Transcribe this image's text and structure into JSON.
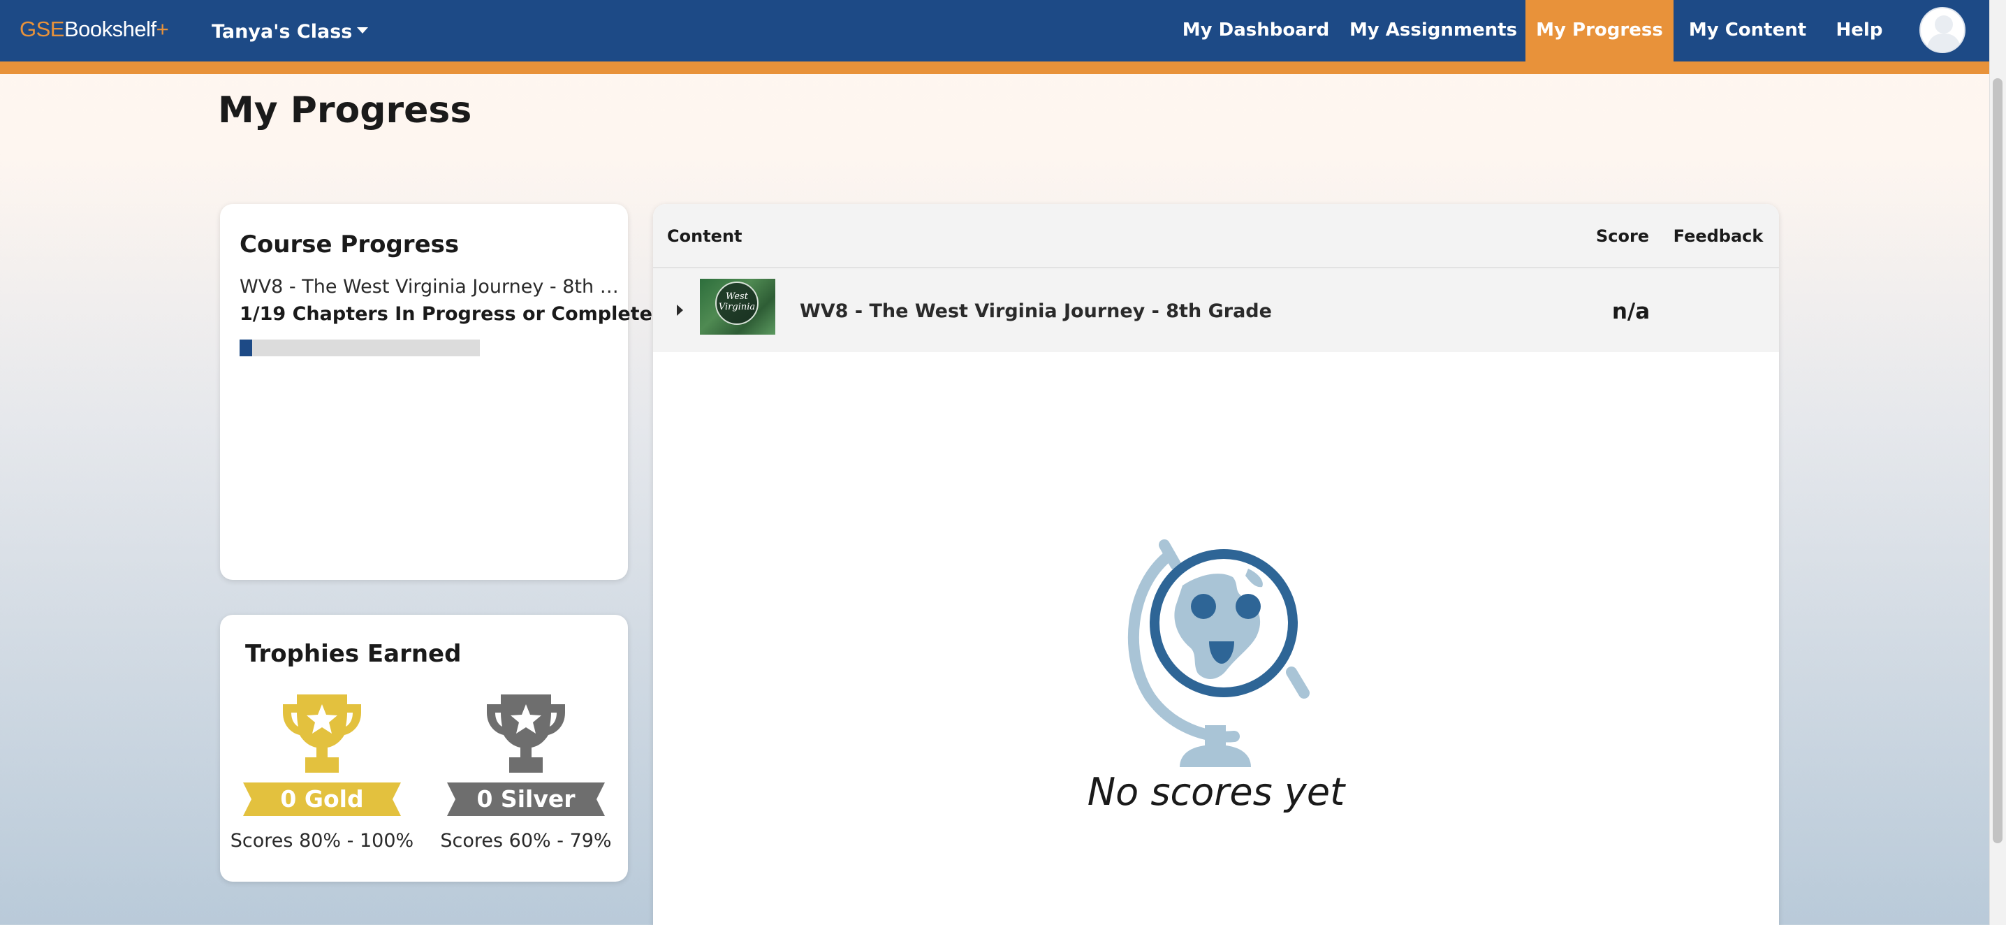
{
  "app": {
    "logo_gse": "GSE",
    "logo_bookshelf": "Bookshelf",
    "logo_plus": "+",
    "class_selector": "Tanya's Class"
  },
  "nav": {
    "items": [
      {
        "label": "My Dashboard",
        "active": false
      },
      {
        "label": "My Assignments",
        "active": false
      },
      {
        "label": "My Progress",
        "active": true
      },
      {
        "label": "My Content",
        "active": false
      },
      {
        "label": "Help",
        "active": false
      }
    ],
    "avatar_icon": "user-avatar-icon"
  },
  "page": {
    "title": "My Progress"
  },
  "course_progress": {
    "title": "Course Progress",
    "course_name": "WV8 - The West Virginia Journey - 8th Grade",
    "chapters_text": "1/19 Chapters In Progress or Complete",
    "chapters_done": 1,
    "chapters_total": 19
  },
  "trophies": {
    "title": "Trophies Earned",
    "gold": {
      "label": "0 Gold",
      "range": "Scores 80% - 100%",
      "icon": "gold-trophy-icon"
    },
    "silver": {
      "label": "0 Silver",
      "range": "Scores 60% - 79%",
      "icon": "silver-trophy-icon"
    }
  },
  "content_table": {
    "columns": {
      "content": "Content",
      "score": "Score",
      "feedback": "Feedback"
    },
    "rows": [
      {
        "thumbnail_text": "West Virginia",
        "title": "WV8 - The West Virginia Journey - 8th Grade",
        "score": "n/a",
        "feedback": ""
      }
    ],
    "empty_state": {
      "icon": "globe-icon",
      "text": "No scores yet"
    }
  },
  "colors": {
    "nav_background": "#1d4a86",
    "accent_orange": "#e8923a",
    "gold": "#e3c13e",
    "silver": "#6e6e6e",
    "globe_light": "#a9c4d6",
    "globe_dark": "#2e6596"
  }
}
